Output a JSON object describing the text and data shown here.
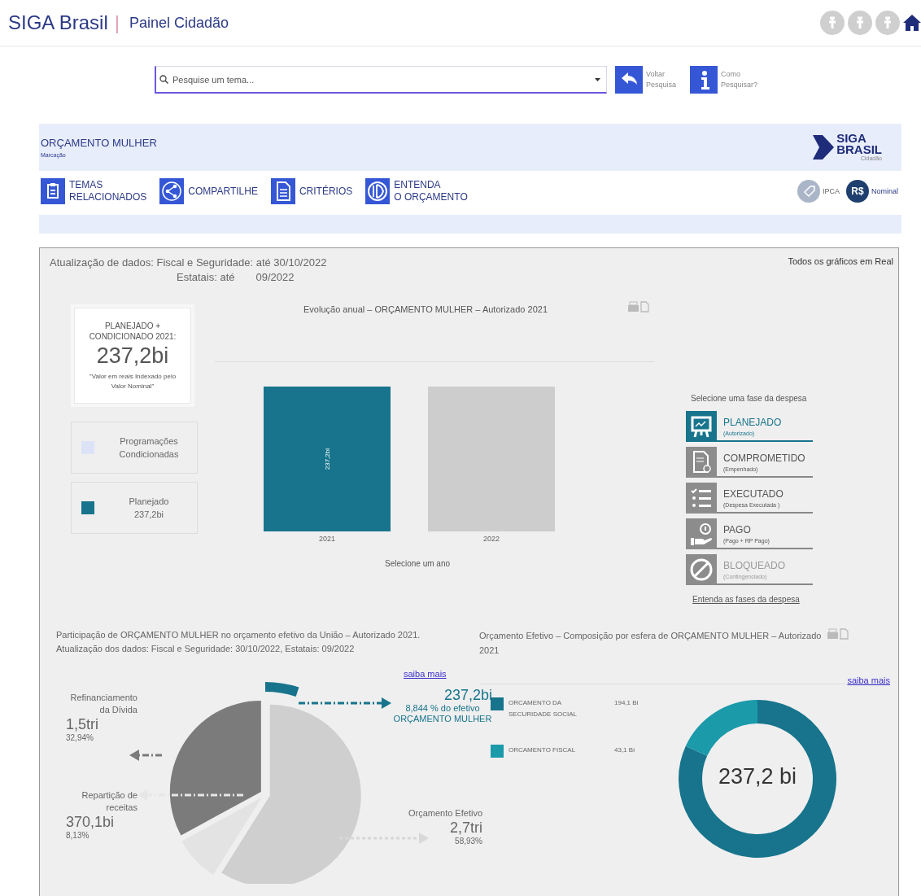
{
  "header": {
    "brand": "SIGA Brasil",
    "separator": "|",
    "subtitle": "Painel Cidadão"
  },
  "search": {
    "placeholder": "Pesquise um tema...",
    "actions": [
      {
        "kind": "back",
        "label": "Voltar Pesquisa"
      },
      {
        "kind": "info",
        "label": "Como Pesquisar?"
      }
    ]
  },
  "panel": {
    "title": "ORÇAMENTO MULHER",
    "subtitle": "Marcação",
    "logo": {
      "line_1": "SIGA",
      "line_2": "BRASIL",
      "tagline": "Cidadão"
    },
    "toolbar": [
      {
        "kind": "list",
        "lines": [
          "TEMAS",
          "RELACIONADOS"
        ]
      },
      {
        "kind": "share",
        "lines": [
          "COMPARTILHE"
        ]
      },
      {
        "kind": "document",
        "lines": [
          "CRITÉRIOS"
        ]
      },
      {
        "kind": "book",
        "lines": [
          "ENTENDA",
          "O ORÇAMENTO"
        ]
      }
    ],
    "value_modes": [
      {
        "kind": "ipca",
        "label": "IPCA",
        "selected": false
      },
      {
        "kind": "nominal",
        "badge": "R$",
        "label": "Nominal",
        "selected": true
      }
    ]
  },
  "dashboard": {
    "update_note": {
      "line_1": "Atualização de dados: Fiscal e Seguridade: até 30/10/2022",
      "line_2_label": "Estatais: até",
      "line_2_value": "09/2022"
    },
    "currency_note": "Todos os gráficos em Real",
    "summary": {
      "label": "PLANEJADO + CONDICIONADO 2021:",
      "value": "237,2bi",
      "note": "\"Valor em reais Indexado pelo Valor Nominal\""
    },
    "legend": [
      {
        "label": "Programações Condicionadas",
        "color": "#dde3f7"
      },
      {
        "label": "Planejado",
        "value": "237,2bi",
        "color": "#17748c"
      }
    ],
    "annual_chart": {
      "title": "Evolução anual – ORÇAMENTO MULHER – Autorizado 2021",
      "hint": "Selecione um ano",
      "bars": [
        {
          "year": "2021",
          "value_label": "237,2bi",
          "selected": true
        },
        {
          "year": "2022",
          "selected": false
        }
      ]
    },
    "phases": {
      "heading": "Selecione uma fase da despesa",
      "link": "Entenda as fases da despesa",
      "items": [
        {
          "kind": "planned",
          "label": "PLANEJADO",
          "sublabel": "(Autorizado)",
          "selected": true,
          "disabled": false
        },
        {
          "kind": "committed",
          "label": "COMPROMETIDO",
          "sublabel": "(Empenhado)",
          "selected": false,
          "disabled": false
        },
        {
          "kind": "executed",
          "label": "EXECUTADO",
          "sublabel": "(Despesa Executada )",
          "selected": false,
          "disabled": false
        },
        {
          "kind": "paid",
          "label": "PAGO",
          "sublabel": "(Pago + RP Pago)",
          "selected": false,
          "disabled": false
        },
        {
          "kind": "blocked",
          "label": "BLOQUEADO",
          "sublabel": "(Contingenciado)",
          "selected": false,
          "disabled": true
        }
      ]
    },
    "share_chart": {
      "title": "Participação de ORÇAMENTO MULHER no orçamento efetivo da União – Autorizado 2021.",
      "subtitle": "Atualização dos dados: Fiscal e Seguridade: 30/10/2022, Estatais: 09/2022",
      "link": "saiba mais",
      "highlight": {
        "value": "237,2bi",
        "share": "8,844 % do efetivo",
        "name": "ORÇAMENTO MULHER"
      },
      "slices": [
        {
          "label": "Refinanciamento da Dívida",
          "value": "1,5tri",
          "share": "32,94%",
          "color": "#7b7b7b"
        },
        {
          "label": "Repartição de receitas",
          "value": "370,1bi",
          "share": "8,13%",
          "color": "#e3e3e3"
        },
        {
          "label": "Orçamento Efetivo",
          "value": "2,7tri",
          "share": "58,93%",
          "color": "#cfcfcf"
        }
      ]
    },
    "composition_chart": {
      "title": "Orçamento Efetivo – Composição por esfera de ORÇAMENTO MULHER – Autorizado 2021",
      "link": "saiba mais",
      "total": "237,2 bi",
      "legend": [
        {
          "label": "ORCAMENTO DA SECURIDADE SOCIAL",
          "value": "194,1 Bi",
          "color": "#17748c"
        },
        {
          "label": "ORCAMENTO FISCAL",
          "value": "43,1 Bi",
          "color": "#1b9aaa"
        }
      ]
    }
  }
}
